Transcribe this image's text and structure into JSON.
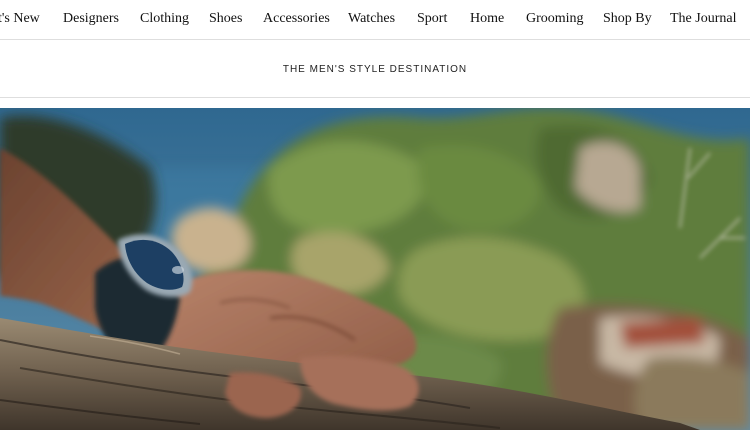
{
  "nav": {
    "items": [
      {
        "label": "t's New"
      },
      {
        "label": "Designers"
      },
      {
        "label": "Clothing"
      },
      {
        "label": "Shoes"
      },
      {
        "label": "Accessories"
      },
      {
        "label": "Watches"
      },
      {
        "label": "Sport"
      },
      {
        "label": "Home"
      },
      {
        "label": "Grooming"
      },
      {
        "label": "Shop By"
      },
      {
        "label": "The Journal"
      }
    ]
  },
  "header": {
    "tagline": "THE MEN'S STYLE DESTINATION"
  },
  "hero": {
    "image": "man-wearing-watch-leaning-on-wooden-rail-coastal-village"
  },
  "colors": {
    "text": "#111111",
    "divider": "#dedede",
    "sky": "#3a6e92"
  }
}
